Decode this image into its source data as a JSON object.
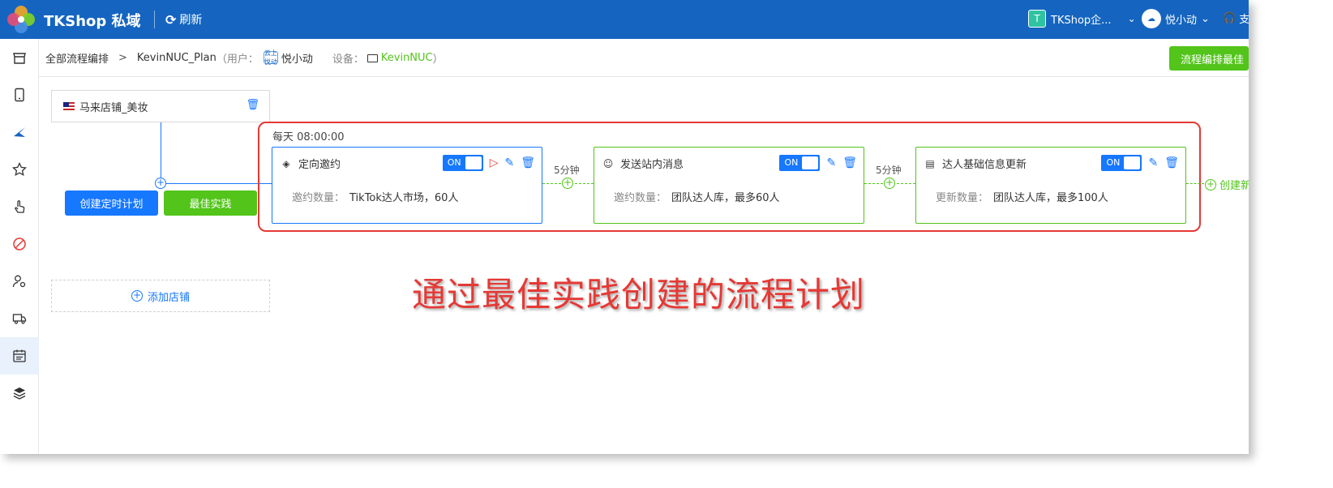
{
  "app": {
    "title": "TKShop 私域",
    "refresh_label": "刷新"
  },
  "header": {
    "tenant_badge": "T",
    "tenant_name": "TKShop企...",
    "user_name": "悦小动",
    "support_label": "支"
  },
  "sidebar": {
    "items": [
      {
        "icon": "store-icon"
      },
      {
        "icon": "phone-icon"
      },
      {
        "icon": "tiktok-icon"
      },
      {
        "icon": "star-icon"
      },
      {
        "icon": "hand-pointer-icon"
      },
      {
        "icon": "ban-icon"
      },
      {
        "icon": "user-settings-icon"
      },
      {
        "icon": "truck-icon"
      },
      {
        "icon": "calendar-icon",
        "active": true
      },
      {
        "icon": "layers-icon"
      }
    ]
  },
  "breadcrumb": {
    "root": "全部流程编排",
    "separator": ">",
    "plan_name": "KevinNUC_Plan",
    "user_prefix": "（用户：",
    "user_avatar_text": "云上悦动",
    "user_name": "悦小动",
    "device_prefix": "设备：",
    "device_name": "KevinNUC",
    "device_suffix": "）",
    "top_button": "流程编排最佳"
  },
  "shop": {
    "name": "马来店铺_美妆"
  },
  "buttons": {
    "create_schedule": "创建定时计划",
    "best_practice": "最佳实践",
    "add_shop": "添加店铺"
  },
  "schedule": {
    "label": "每天  08:00:00"
  },
  "steps": [
    {
      "title": "定向邀约",
      "toggle": "ON",
      "body_key": "邀约数量：",
      "body_value": "TikTok达人市场，60人"
    },
    {
      "title": "发送站内消息",
      "toggle": "ON",
      "body_key": "邀约数量：",
      "body_value": "团队达人库，最多60人"
    },
    {
      "title": "达人基础信息更新",
      "toggle": "ON",
      "body_key": "更新数量：",
      "body_value": "团队达人库，最多100人"
    }
  ],
  "connectors": [
    {
      "label": "5分钟"
    },
    {
      "label": "5分钟"
    }
  ],
  "tail": {
    "label": "创建新"
  },
  "annotation": {
    "text": "通过最佳实践创建的流程计划"
  },
  "colors": {
    "primary": "#1677ff",
    "green": "#52c41a",
    "topbar": "#1565c0",
    "highlight": "#e53935"
  }
}
